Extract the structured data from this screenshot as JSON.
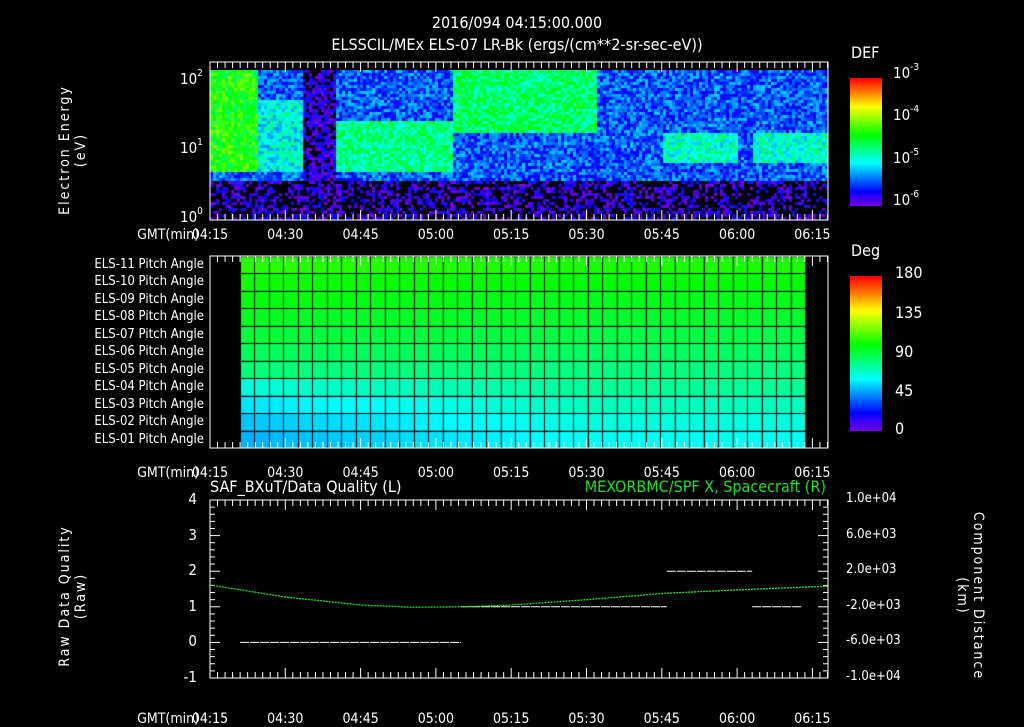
{
  "header": {
    "datetime": "2016/094 04:15:00.000",
    "title": "ELSSCIL/MEx ELS-07 LR-Bk  (ergs/(cm**2-sr-sec-eV))"
  },
  "time_axis": {
    "label": "GMT(min)",
    "ticks": [
      "04:15",
      "04:30",
      "04:45",
      "05:00",
      "05:15",
      "05:30",
      "05:45",
      "06:00",
      "06:15"
    ]
  },
  "chart_data": [
    {
      "type": "heatmap",
      "name": "electron-spectrogram",
      "title": "ELSSCIL/MEx ELS-07 LR-Bk  (ergs/(cm**2-sr-sec-eV))",
      "ylabel": "Electron Energy",
      "yunit": "(eV)",
      "ylim": [
        1,
        150
      ],
      "yscale": "log",
      "yticks": [
        {
          "base": "10",
          "exp": "2",
          "value": 100
        },
        {
          "base": "10",
          "exp": "1",
          "value": 10
        },
        {
          "base": "10",
          "exp": "0",
          "value": 1
        }
      ],
      "colorbar": {
        "label": "DEF",
        "ticks": [
          {
            "base": "10",
            "exp": "-3"
          },
          {
            "base": "10",
            "exp": "-4"
          },
          {
            "base": "10",
            "exp": "-5"
          },
          {
            "base": "10",
            "exp": "-6"
          }
        ],
        "range_log": [
          -6.2,
          -3
        ]
      },
      "regions": [
        {
          "t": [
            "04:15",
            "04:24"
          ],
          "e": [
            5,
            150
          ],
          "log_def": -4.4
        },
        {
          "t": [
            "04:24",
            "04:33"
          ],
          "e": [
            5,
            60
          ],
          "log_def": -5.1
        },
        {
          "t": [
            "04:40",
            "05:03"
          ],
          "e": [
            5,
            30
          ],
          "log_def": -4.8
        },
        {
          "t": [
            "05:03",
            "05:32"
          ],
          "e": [
            20,
            150
          ],
          "log_def": -4.7
        },
        {
          "t": [
            "05:45",
            "06:00"
          ],
          "e": [
            7,
            20
          ],
          "log_def": -5.0
        },
        {
          "t": [
            "06:03",
            "06:18"
          ],
          "e": [
            7,
            20
          ],
          "log_def": -5.0
        }
      ]
    },
    {
      "type": "heatmap",
      "name": "pitch-angle",
      "rows": [
        "ELS-11 Pitch Angle",
        "ELS-10 Pitch Angle",
        "ELS-09 Pitch Angle",
        "ELS-08 Pitch Angle",
        "ELS-07 Pitch Angle",
        "ELS-06 Pitch Angle",
        "ELS-05 Pitch Angle",
        "ELS-04 Pitch Angle",
        "ELS-03 Pitch Angle",
        "ELS-02 Pitch Angle",
        "ELS-01 Pitch Angle"
      ],
      "time_range": [
        "04:21",
        "06:14"
      ],
      "values_start_deg": [
        106,
        102,
        98,
        95,
        91,
        86,
        81,
        66,
        56,
        51,
        48
      ],
      "values_end_deg": [
        104,
        100,
        96,
        93,
        89,
        85,
        80,
        76,
        70,
        65,
        62
      ],
      "colorbar": {
        "label": "Deg",
        "ticks": [
          "180",
          "135",
          "90",
          "45",
          "0"
        ],
        "range": [
          0,
          180
        ]
      }
    },
    {
      "type": "line",
      "name": "data-quality-and-position",
      "title_left": "SAF_BXuT/Data Quality (L)",
      "title_right": "MEXORBMC/SPF X, Spacecraft (R)",
      "ylabel_left": "Raw Data Quality",
      "yunit_left": "(Raw)",
      "ylabel_right": "Component Distance",
      "yunit_right": "(km)",
      "ylim_left": [
        -1,
        4
      ],
      "yticks_left": [
        "4",
        "3",
        "2",
        "1",
        "0",
        "-1"
      ],
      "ylim_right": [
        -10000,
        10000
      ],
      "yticks_right": [
        "1.0e+04",
        "6.0e+03",
        "2.0e+03",
        "-2.0e+03",
        "-6.0e+03",
        "-1.0e+04"
      ],
      "series": [
        {
          "name": "Data Quality",
          "color": "#ffffff",
          "segments": [
            {
              "t": [
                "04:21",
                "05:05"
              ],
              "value": 0
            },
            {
              "t": [
                "05:05",
                "05:46"
              ],
              "value": 1
            },
            {
              "t": [
                "05:46",
                "06:03"
              ],
              "value": 2
            },
            {
              "t": [
                "06:03",
                "06:13"
              ],
              "value": 1
            }
          ]
        },
        {
          "name": "SPF X",
          "color": "#22dd22",
          "x": [
            "04:15",
            "04:30",
            "04:45",
            "04:55",
            "05:05",
            "05:15",
            "05:30",
            "05:45",
            "06:00",
            "06:15",
            "06:18"
          ],
          "values": [
            450,
            -900,
            -1800,
            -2050,
            -2000,
            -1800,
            -1200,
            -500,
            -100,
            250,
            300
          ]
        }
      ]
    }
  ]
}
